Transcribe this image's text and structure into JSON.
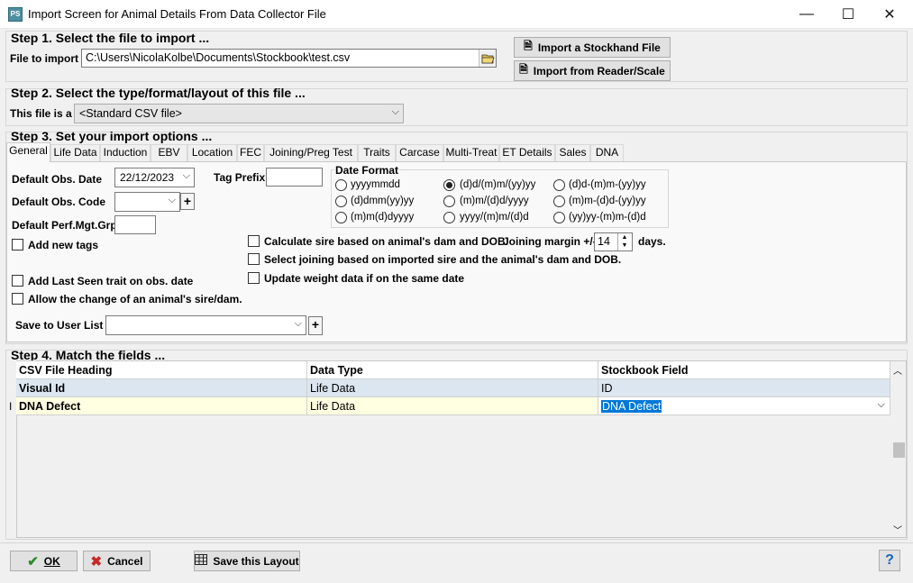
{
  "window": {
    "title": "Import Screen for Animal Details From Data Collector File",
    "icon_text": "PS",
    "controls": {
      "minimize": "—",
      "maximize": "☐",
      "close": "✕"
    }
  },
  "step1": {
    "heading": "Step 1. Select the file to import ...",
    "file_label": "File to import",
    "file_value": "C:\\Users\\NicolaKolbe\\Documents\\Stockbook\\test.csv",
    "stockhand_button": "Import a Stockhand File",
    "reader_button": "Import from Reader/Scale"
  },
  "step2": {
    "heading": "Step 2. Select the type/format/layout of this file ...",
    "type_label": "This file is a",
    "type_value": "<Standard CSV file>"
  },
  "step3": {
    "heading": "Step 3. Set your import options ...",
    "tabs": [
      "General",
      "Life Data",
      "Induction",
      "EBV",
      "Location",
      "FEC",
      "Joining/Preg Test",
      "Traits",
      "Carcase",
      "Multi-Treat",
      "ET Details",
      "Sales",
      "DNA"
    ],
    "obs_date_label": "Default Obs. Date",
    "obs_date_value": "22/12/2023",
    "obs_code_label": "Default Obs. Code",
    "obs_code_value": "",
    "perf_label": "Default Perf.Mgt.Grp",
    "perf_value": "",
    "tag_prefix_label": "Tag Prefix",
    "tag_prefix_value": "",
    "date_format_label": "Date Format",
    "date_formats": [
      "yyyymmdd",
      "(d)d/(m)m/(yy)yy",
      "(d)d-(m)m-(yy)yy",
      "(d)dmm(yy)yy",
      "(m)m/(d)d/yyyy",
      "(m)m-(d)d-(yy)yy",
      "(m)m(d)dyyyy",
      "yyyy/(m)m/(d)d",
      "(yy)yy-(m)m-(d)d"
    ],
    "selected_date_format": "(d)d/(m)m/(yy)yy",
    "add_new_tags": "Add new tags",
    "calc_sire": "Calculate sire based on animal's dam and DOB.",
    "joining_margin_label": "Joining margin +/-",
    "joining_margin_value": "14",
    "joining_margin_unit": "days.",
    "select_joining": "Select joining based on imported sire and the animal's dam and DOB.",
    "update_weight": "Update weight data if on the same date",
    "add_last_seen": "Add Last Seen trait on obs. date",
    "allow_change": "Allow the change of an animal's sire/dam.",
    "user_list_label": "Save to User List",
    "user_list_value": ""
  },
  "step4": {
    "heading": "Step 4. Match the fields ...",
    "columns": [
      "CSV File Heading",
      "Data Type",
      "Stockbook Field"
    ],
    "rows": [
      {
        "heading": "Visual Id",
        "type": "Life Data",
        "field": "ID"
      },
      {
        "heading": "DNA Defect",
        "type": "Life Data",
        "field": "DNA Defect"
      }
    ]
  },
  "footer": {
    "ok": "OK",
    "cancel": "Cancel",
    "save_layout": "Save this Layout",
    "help": "?"
  },
  "colors": {
    "selected_row": "#dbe6f0",
    "active_row": "#ffffe1",
    "highlight": "#0078d7"
  }
}
